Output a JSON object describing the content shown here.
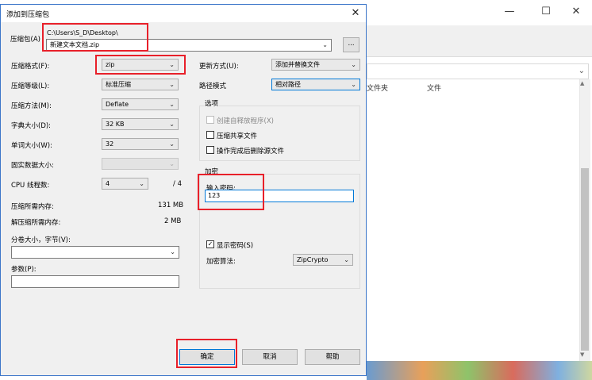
{
  "background_window": {
    "controls": {
      "minimize_glyph": "—",
      "maximize_glyph": "☐",
      "close_glyph": "✕"
    },
    "columns": [
      "文件夹",
      "文件"
    ],
    "address_chevron": "⌄"
  },
  "dialog": {
    "title": "添加到压缩包",
    "close_glyph": "✕",
    "archive": {
      "label": "压缩包(A)",
      "path": "C:\\Users\\S_D\\Desktop\\",
      "filename": "新建文本文档.zip",
      "browse_label": "..."
    },
    "left": {
      "format": {
        "label": "压缩格式(F):",
        "value": "zip"
      },
      "level": {
        "label": "压缩等级(L):",
        "value": "标准压缩"
      },
      "method": {
        "label": "压缩方法(M):",
        "value": "Deflate"
      },
      "dict_size": {
        "label": "字典大小(D):",
        "value": "32 KB"
      },
      "word_size": {
        "label": "单词大小(W):",
        "value": "32"
      },
      "solid": {
        "label": "固实数据大小:",
        "value": ""
      },
      "threads": {
        "label": "CPU 线程数:",
        "value": "4",
        "max": "/ 4"
      },
      "mem_compress": {
        "label": "压缩所需内存:",
        "value": "131 MB"
      },
      "mem_decompress": {
        "label": "解压缩所需内存:",
        "value": "2 MB"
      },
      "split": {
        "label": "分卷大小，字节(V):",
        "value": ""
      },
      "params": {
        "label": "参数(P):",
        "value": ""
      }
    },
    "right": {
      "update_mode": {
        "label": "更新方式(U):",
        "value": "添加并替换文件"
      },
      "path_mode": {
        "label": "路径模式",
        "value": "相对路径"
      },
      "options": {
        "title": "选项",
        "sfx": {
          "label": "创建自释放程序(X)",
          "checked": false,
          "enabled": false
        },
        "shared": {
          "label": "压缩共享文件",
          "checked": false,
          "enabled": true
        },
        "delete_after": {
          "label": "操作完成后删除源文件",
          "checked": false,
          "enabled": true
        }
      },
      "encryption": {
        "title": "加密",
        "password_label": "输入密码:",
        "password_value": "123",
        "show_password": {
          "label": "显示密码(S)",
          "checked": true
        },
        "method_label": "加密算法:",
        "method_value": "ZipCrypto"
      }
    },
    "buttons": {
      "ok": "确定",
      "cancel": "取消",
      "help": "帮助"
    },
    "chevron": "⌄",
    "check_mark": "✓"
  }
}
